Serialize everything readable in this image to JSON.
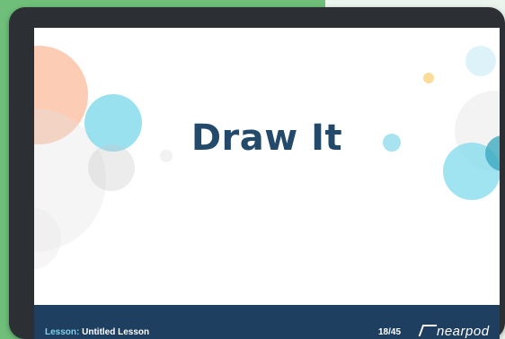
{
  "slide": {
    "title": "Draw It"
  },
  "footer": {
    "lesson_label": "Lesson:",
    "lesson_name": "Untitled Lesson",
    "page_counter": "18/45",
    "brand": "nearpod"
  },
  "colors": {
    "title": "#23496b",
    "footer_bg": "#1f3f60",
    "lesson_label": "#7fd0e8",
    "background_green": "#6fbf7a"
  }
}
